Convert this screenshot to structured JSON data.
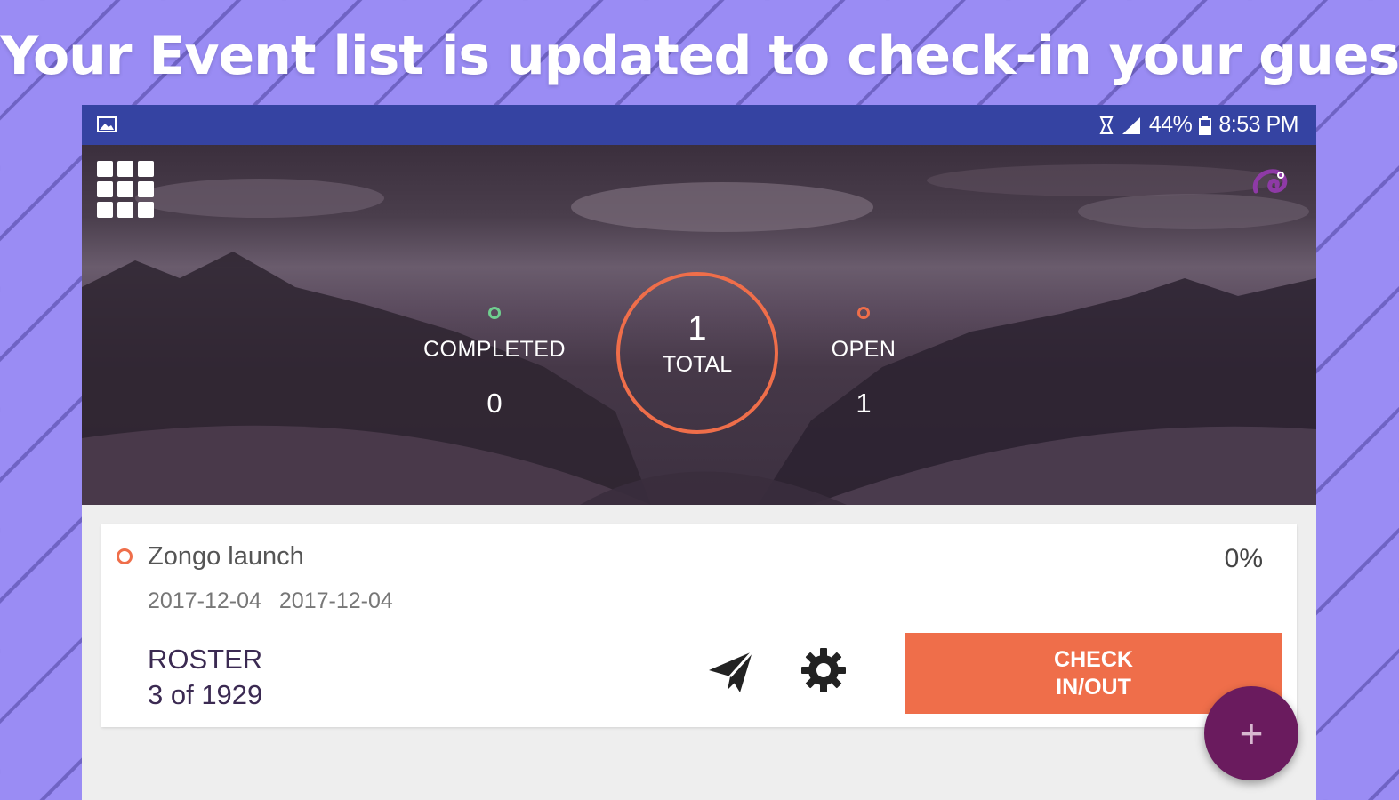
{
  "headline": "Your Event list is updated to check-in your guest.",
  "status_bar": {
    "battery": "44%",
    "time": "8:53 PM",
    "icons": [
      "image-icon",
      "alarm-icon",
      "signal-icon",
      "battery-icon"
    ]
  },
  "header": {
    "menu_icon": "grid-menu-icon",
    "logo_icon": "chameleon-logo-icon",
    "stats": {
      "completed": {
        "label": "COMPLETED",
        "value": "0"
      },
      "total": {
        "label": "TOTAL",
        "value": "1"
      },
      "open": {
        "label": "OPEN",
        "value": "1"
      }
    }
  },
  "event": {
    "title": "Zongo launch",
    "start_date": "2017-12-04",
    "end_date": "2017-12-04",
    "percent": "0%",
    "roster_label": "ROSTER",
    "roster_count": "3 of 1929",
    "checkin_label": "CHECK\nIN/OUT"
  },
  "fab": {
    "symbol": "+"
  },
  "colors": {
    "accent": "#ef6e4a",
    "status_bar": "#3543a2",
    "completed_dot": "#6fcf8f",
    "fab": "#6a1b5e",
    "background": "#9a8cf4"
  }
}
